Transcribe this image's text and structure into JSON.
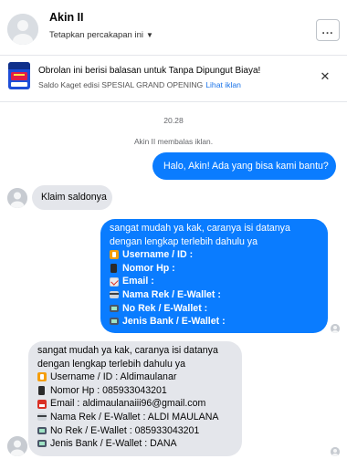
{
  "header": {
    "contact_name": "Akin II",
    "subtitle": "Tetapkan percakapan ini",
    "more_label": "..."
  },
  "promo": {
    "title": "Obrolan ini berisi balasan untuk Tanpa Dipungut Biaya!",
    "subtitle": "Saldo Kaget edisi SPESIAL GRAND OPENING",
    "link": "Lihat iklan",
    "close": "✕"
  },
  "conversation": {
    "timestamp": "20.28",
    "system_message": "Akin II membalas iklan.",
    "messages": [
      {
        "from": "page",
        "text": "Halo, Akin! Ada yang bisa kami bantu?"
      },
      {
        "from": "user",
        "text": "Klaim saldonya"
      },
      {
        "from": "page",
        "lines": [
          {
            "icon": "",
            "text": "sangat mudah ya kak, caranya isi datanya"
          },
          {
            "icon": "",
            "text": "dengan lengkap terlebih dahulu ya"
          },
          {
            "icon": "id-icon",
            "text": "Username / ID :"
          },
          {
            "icon": "phone-icon",
            "text": "Nomor Hp :"
          },
          {
            "icon": "mail-icon",
            "text": "Email :"
          },
          {
            "icon": "card-icon",
            "text": "Nama Rek / E-Wallet :"
          },
          {
            "icon": "atm-icon",
            "text": "No Rek / E-Wallet :"
          },
          {
            "icon": "atm-icon",
            "text": "Jenis Bank / E-Wallet :"
          }
        ]
      },
      {
        "from": "user",
        "lines": [
          {
            "icon": "",
            "text": "sangat mudah ya kak, caranya isi datanya"
          },
          {
            "icon": "",
            "text": "dengan lengkap terlebih dahulu ya"
          },
          {
            "icon": "id-icon",
            "text": "Username / ID : Aldimaulanar"
          },
          {
            "icon": "phone-icon",
            "text": "Nomor Hp : 085933043201"
          },
          {
            "icon": "inbox-icon",
            "text": "Email : aldimaulanaiii96@gmail.com"
          },
          {
            "icon": "card-icon",
            "text": "Nama Rek / E-Wallet : ALDI MAULANA"
          },
          {
            "icon": "atm-icon",
            "text": "No Rek / E-Wallet : 085933043201"
          },
          {
            "icon": "atm-icon",
            "text": "Jenis Bank / E-Wallet : DANA"
          }
        ]
      }
    ]
  },
  "colors": {
    "outgoing_bubble": "#0a7cff",
    "incoming_bubble": "#e4e6eb",
    "link": "#1a73e8"
  }
}
